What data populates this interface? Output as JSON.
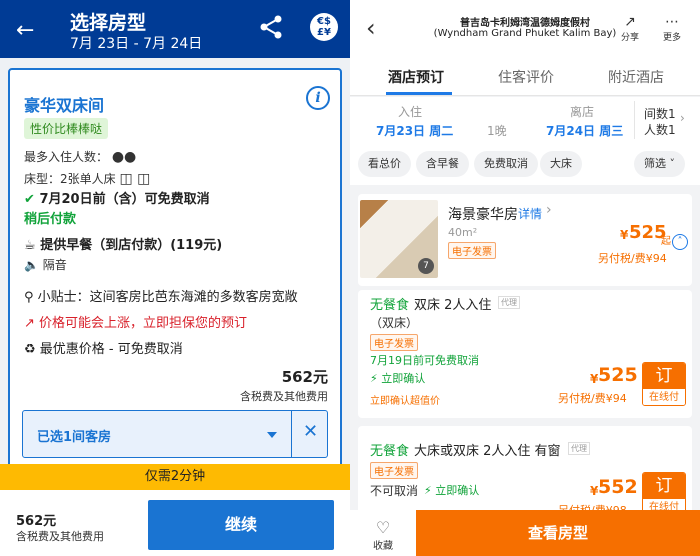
{
  "left": {
    "header": {
      "title": "选择房型",
      "dates": "7月 23日 - 7月 24日",
      "currency_label": "€$\n£¥"
    },
    "room": {
      "name": "豪华双床间",
      "value_badge": "性价比棒棒哒",
      "max_guests_label": "最多入住人数：",
      "bed_label": "床型：",
      "bed_value": "2张单人床",
      "cancel": "7月20日前（含）可免费取消",
      "pay_later": "稍后付款",
      "breakfast": "提供早餐（到店付款）(119元)",
      "soundproof": "隔音",
      "tip": "小贴士：这间客房比芭东海滩的多数客房宽敞",
      "price_warning": "价格可能会上涨，立即担保您的预订",
      "best_price": "最优惠价格 - 可免费取消",
      "price": "562元",
      "price_sub": "含税费及其他费用",
      "selected": "已选1间客房"
    },
    "timer": "仅需2分钟",
    "footer": {
      "price": "562元",
      "price_sub": "含税费及其他费用",
      "continue": "继续"
    }
  },
  "right": {
    "header": {
      "hotel_cn": "普吉岛卡利姆湾温德姆度假村",
      "hotel_en": "(Wyndham Grand Phuket Kalim Bay)",
      "share": "分享",
      "more": "更多"
    },
    "tabs": [
      "酒店预订",
      "住客评价",
      "附近酒店"
    ],
    "dates": {
      "checkin_label": "入住",
      "checkin": "7月23日 周二",
      "nights": "1晚",
      "checkout_label": "离店",
      "checkout": "7月24日 周三",
      "rooms": "间数1",
      "guests": "人数1"
    },
    "filters": [
      "看总价",
      "含早餐",
      "免费取消",
      "大床",
      "筛选"
    ],
    "room": {
      "name": "海景豪华房",
      "details": "详情",
      "area": "40m²",
      "invoice": "电子发票",
      "photo_count": "7",
      "currency": "¥",
      "price": "525",
      "price_suffix": "起",
      "tax": "另付税/费¥94"
    },
    "offers": [
      {
        "meal": "无餐食",
        "title": "双床 2人入住",
        "agent": "代理",
        "bed": "（双床）",
        "invoice": "电子发票",
        "cancel": "7月19日前可免费取消",
        "confirm": "立即确认",
        "deal": "立即确认超值价",
        "currency": "¥",
        "price": "525",
        "tax": "另付税/费¥94",
        "book": "订",
        "pay": "在线付"
      },
      {
        "meal": "无餐食",
        "title": "大床或双床 2人入住 有窗",
        "agent": "代理",
        "invoice": "电子发票",
        "cancel": "不可取消",
        "confirm": "立即确认",
        "currency": "¥",
        "price": "552",
        "tax": "另付税/费¥98",
        "book": "订",
        "pay": "在线付"
      }
    ],
    "footer": {
      "favorite": "收藏",
      "view_rooms": "查看房型"
    }
  }
}
